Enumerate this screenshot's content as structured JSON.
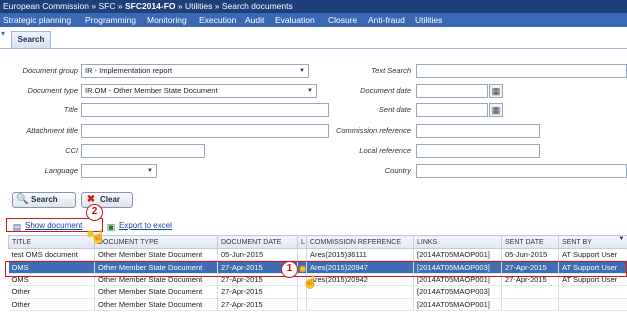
{
  "breadcrumb": {
    "items": [
      "European Commission",
      "SFC",
      "SFC2014-FO",
      "Utilities",
      "Search documents"
    ],
    "separator": "»"
  },
  "menu": {
    "items": [
      "Strategic planning",
      "Programming",
      "Monitoring",
      "Execution",
      "Audit",
      "Evaluation",
      "Closure",
      "Anti-fraud",
      "Utilities"
    ]
  },
  "tab": {
    "label": "Search"
  },
  "form": {
    "document_group": {
      "label": "Document group",
      "value": "IR - Implementation report"
    },
    "document_type": {
      "label": "Document type",
      "value": "IR.OM - Other Member State Document"
    },
    "title": {
      "label": "Title",
      "value": ""
    },
    "attachment_title": {
      "label": "Attachment title",
      "value": ""
    },
    "cci": {
      "label": "CCI",
      "value": ""
    },
    "language": {
      "label": "Language",
      "value": ""
    },
    "text_search": {
      "label": "Text Search",
      "value": ""
    },
    "document_date": {
      "label": "Document date",
      "value": ""
    },
    "sent_date": {
      "label": "Sent date",
      "value": ""
    },
    "commission_reference": {
      "label": "Commission reference",
      "value": ""
    },
    "local_reference": {
      "label": "Local reference",
      "value": ""
    },
    "country": {
      "label": "Country",
      "value": ""
    }
  },
  "buttons": {
    "search": "Search",
    "clear": "Clear"
  },
  "actions": {
    "show_document": "Show document",
    "export_excel": "Export to excel"
  },
  "callouts": {
    "one": "1",
    "two": "2"
  },
  "table": {
    "columns": [
      "TITLE",
      "DOCUMENT TYPE",
      "DOCUMENT DATE",
      "L",
      "COMMISSION REFERENCE",
      "LINKS",
      "SENT DATE",
      "SENT BY"
    ],
    "rows": [
      [
        "test OMS document",
        "Other Member State Document",
        "05-Jun-2015",
        "",
        "Ares(2015)36111",
        "[2014AT05MAOP001]",
        "05-Jun-2015",
        "AT Support User"
      ],
      [
        "OMS",
        "Other Member State Document",
        "27-Apr-2015",
        "",
        "Ares(2015)20947",
        "[2014AT05MAOP003]",
        "27-Apr-2015",
        "AT Support User"
      ],
      [
        "OMS",
        "Other Member State Document",
        "27-Apr-2015",
        "",
        "Ares(2015)20942",
        "[2014AT05MAOP001]",
        "27-Apr-2015",
        "AT Support User"
      ],
      [
        "Other",
        "Other Member State Document",
        "27-Apr-2015",
        "",
        "",
        "[2014AT05MAOP003]",
        "",
        ""
      ],
      [
        "Other",
        "Other Member State Document",
        "27-Apr-2015",
        "",
        "",
        "[2014AT05MAOP001]",
        "",
        ""
      ]
    ],
    "selected_row": 1
  }
}
